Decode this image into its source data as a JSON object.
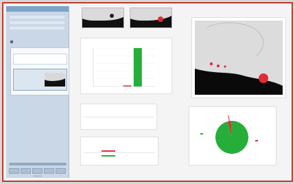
{
  "sidebar": {
    "title": "",
    "group_header": "",
    "items": [
      {
        "label": ""
      },
      {
        "label": ""
      }
    ]
  },
  "summary_card": {
    "title": ""
  },
  "table_card": {
    "title": "",
    "headers": [
      "",
      "",
      ""
    ],
    "rows": [
      [
        "",
        "",
        ""
      ]
    ]
  },
  "score_card": {
    "title": "",
    "headers": [
      "",
      "",
      "",
      "",
      ""
    ],
    "rows": [
      [
        "",
        "",
        "",
        "",
        ""
      ]
    ]
  },
  "pie_card": {
    "title": "",
    "green_label": "",
    "red_label": ""
  },
  "colors": {
    "accent": "#7fa3c7",
    "green": "#27ae3a",
    "red": "#e02b3c",
    "frame": "#c0392b"
  },
  "chart_data": {
    "type": "bar",
    "categories": [
      "",
      ""
    ],
    "values": [
      2,
      100
    ],
    "colors": [
      "#e02b3c",
      "#27ae3a"
    ],
    "ylim": [
      0,
      100
    ],
    "title": "",
    "xlabel": "",
    "ylabel": ""
  },
  "pie_chart_data": {
    "type": "pie",
    "values": [
      97,
      3
    ],
    "colors": [
      "#27ae3a",
      "#e02b3c"
    ]
  }
}
